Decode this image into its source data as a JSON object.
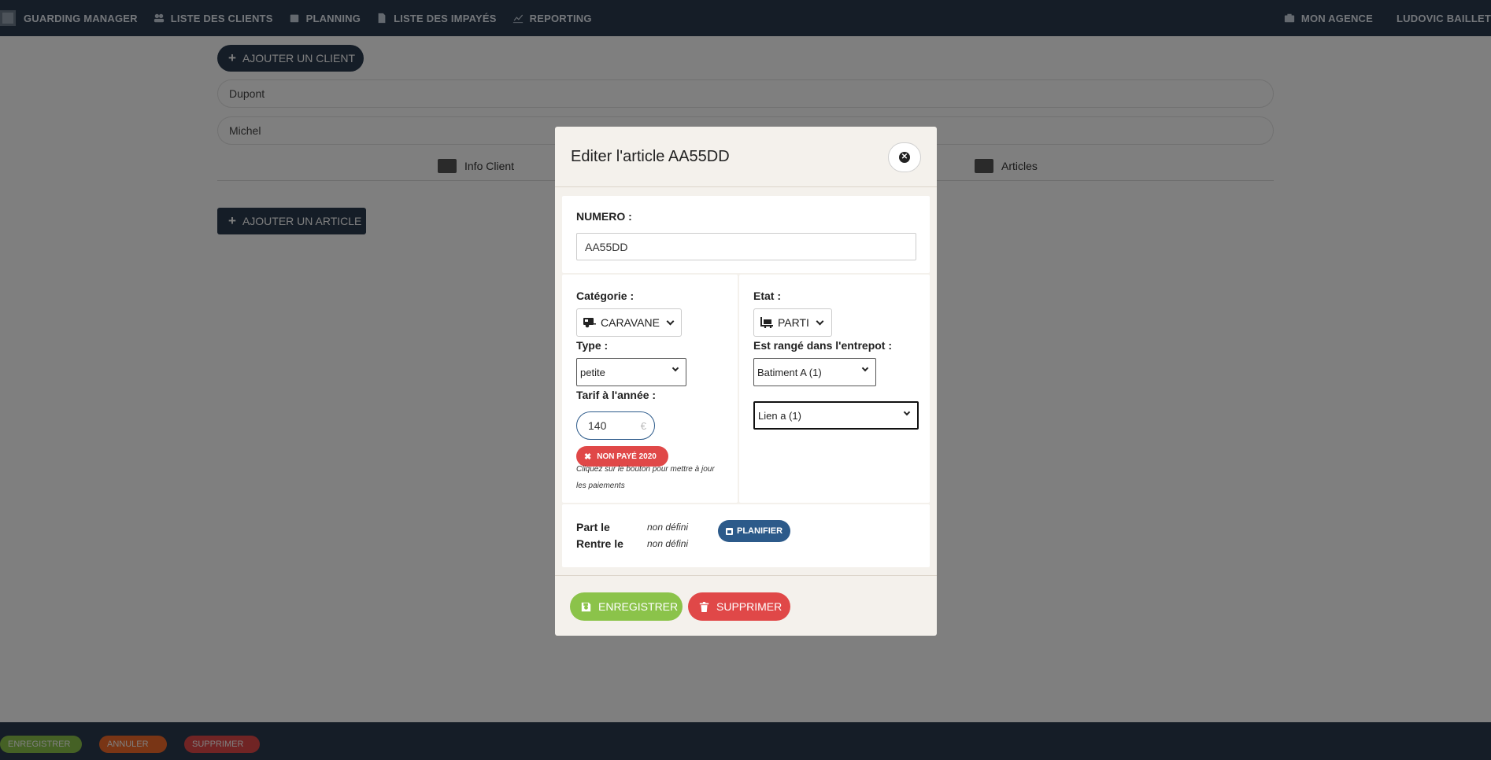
{
  "nav": {
    "brand": "Guarding Manager",
    "items": [
      {
        "label": "Liste des clients",
        "icon": "users-icon"
      },
      {
        "label": "Planning",
        "icon": "calendar-icon"
      },
      {
        "label": "Liste des impayés",
        "icon": "document-icon"
      },
      {
        "label": "Reporting",
        "icon": "chart-icon"
      }
    ],
    "agency": "Mon agence",
    "user": "Ludovic Baillet"
  },
  "background": {
    "add_client_label": "Ajouter un client",
    "last_name": "Dupont",
    "first_name": "Michel",
    "tabs": [
      "Info Client",
      "Articles"
    ],
    "add_article_label": "Ajouter un article",
    "footer": {
      "save": "Enregistrer",
      "cancel": "Annuler",
      "delete": "Supprimer"
    }
  },
  "modal": {
    "title": "Editer l'article AA55DD",
    "numero_label": "NUMERO :",
    "numero_value": "AA55DD",
    "categorie_label": "Catégorie :",
    "categorie_value": "CARAVANE",
    "type_label": "Type :",
    "type_value": "petite",
    "tarif_label": "Tarif à l'année :",
    "tarif_value": "140",
    "tarif_unit": "€",
    "unpaid_badge": "Non payé 2020",
    "hint": "Cliquez sur le bouton pour mettre à jour les paiements",
    "etat_label": "Etat :",
    "etat_value": "PARTI",
    "entrepot_label": "Est rangé dans l'entrepot :",
    "entrepot_value": "Batiment A (1)",
    "lien_value": "Lien a (1)",
    "part_label": "Part le",
    "part_value": "non défini",
    "rentre_label": "Rentre le",
    "rentre_value": "non défini",
    "plan_label": "Planifier",
    "save_label": "Enregistrer",
    "delete_label": "Supprimer"
  },
  "colors": {
    "navbar": "#2b3a4f",
    "save": "#8bc34a",
    "delete": "#e04848",
    "cancel": "#f36a2a",
    "plan": "#2c5a8a"
  }
}
